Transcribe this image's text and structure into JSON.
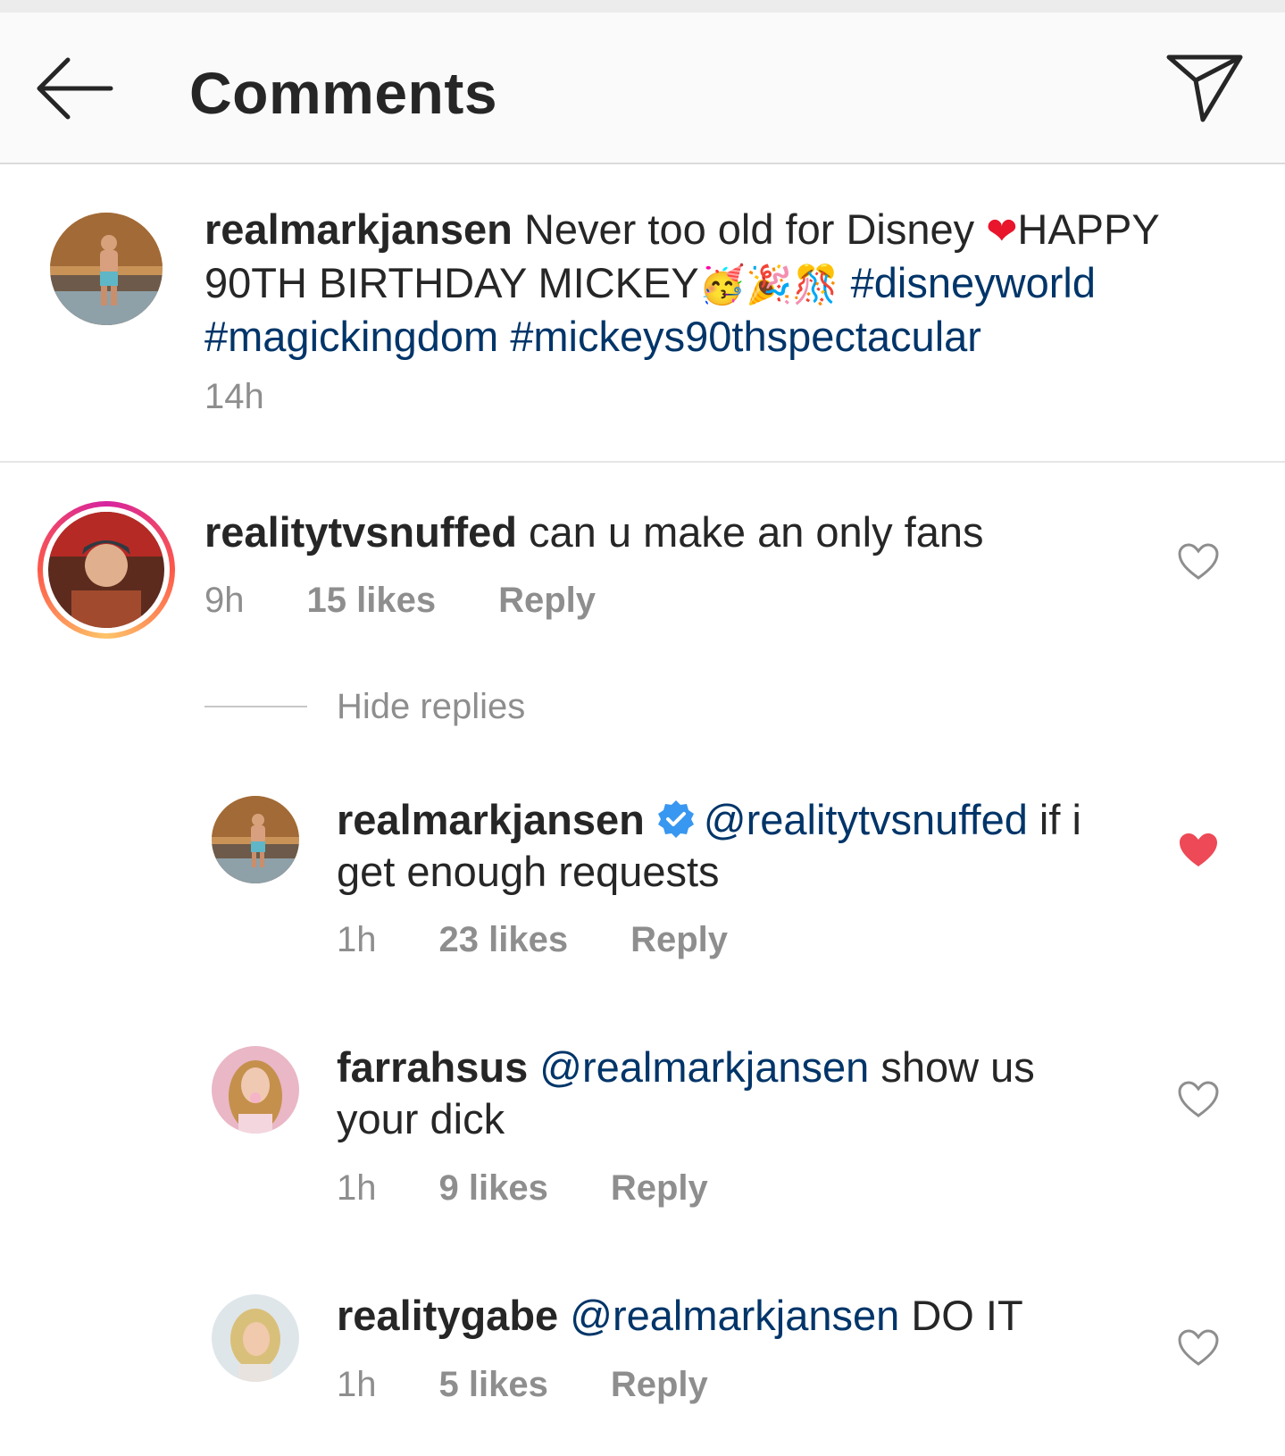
{
  "header": {
    "title": "Comments"
  },
  "caption": {
    "username": "realmarkjansen",
    "text": "Never too old for Disney",
    "heart_emoji": "❤",
    "text2": "HAPPY 90TH BIRTHDAY MICKEY",
    "emojis": "🥳🎉🎊",
    "hashtag1": "#disneyworld",
    "hashtag2": "#magickingdom",
    "hashtag3": "#mickeys90thspectacular",
    "time": "14h"
  },
  "comments": [
    {
      "username": "realitytvsnuffed",
      "text": "can u make an only fans",
      "time": "9h",
      "likes": "15 likes",
      "reply": "Reply",
      "liked": false
    }
  ],
  "hide_replies": "Hide replies",
  "replies": [
    {
      "username": "realmarkjansen",
      "verified": true,
      "mention": "@realitytvsnuffed",
      "text": "if i get enough requests",
      "time": "1h",
      "likes": "23 likes",
      "reply": "Reply",
      "liked": true
    },
    {
      "username": "farrahsus",
      "mention": "@realmarkjansen",
      "text": "show us your dick",
      "time": "1h",
      "likes": "9 likes",
      "reply": "Reply",
      "liked": false
    },
    {
      "username": "realitygabe",
      "mention": "@realmarkjansen",
      "text": "DO IT",
      "time": "1h",
      "likes": "5 likes",
      "reply": "Reply",
      "liked": false
    }
  ],
  "colors": {
    "link": "#003569",
    "muted": "#8e8e8e",
    "liked_heart": "#ed4956",
    "verified_blue": "#3897f0"
  }
}
